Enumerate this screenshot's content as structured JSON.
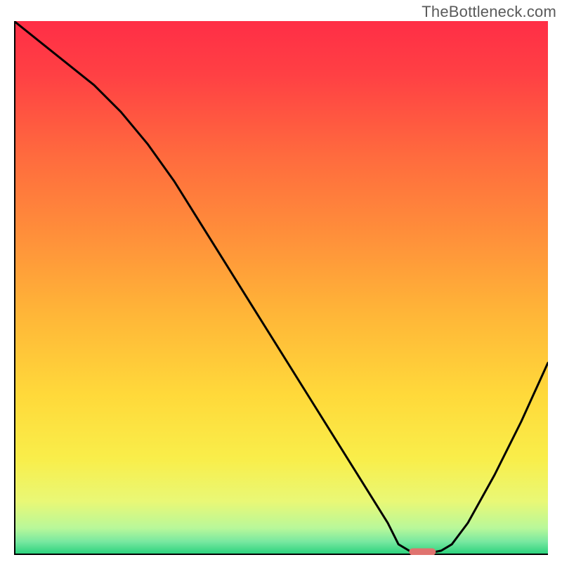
{
  "watermark": "TheBottleneck.com",
  "chart_data": {
    "type": "line",
    "title": "",
    "xlabel": "",
    "ylabel": "",
    "xlim": [
      0,
      100
    ],
    "ylim": [
      0,
      100
    ],
    "x": [
      0,
      5,
      10,
      15,
      20,
      25,
      30,
      35,
      40,
      45,
      50,
      55,
      60,
      65,
      70,
      72,
      74,
      76,
      78,
      80,
      82,
      85,
      90,
      95,
      100
    ],
    "values": [
      100,
      96,
      92,
      88,
      83,
      77,
      70,
      62,
      54,
      46,
      38,
      30,
      22,
      14,
      6,
      2,
      0.8,
      0.4,
      0.4,
      0.8,
      2,
      6,
      15,
      25,
      36
    ],
    "marker": {
      "x_range": [
        74,
        79
      ],
      "y": 0.6
    },
    "gradient_stops": [
      {
        "offset": 0.0,
        "color": "#ff2e46"
      },
      {
        "offset": 0.1,
        "color": "#ff4044"
      },
      {
        "offset": 0.25,
        "color": "#ff6a3e"
      },
      {
        "offset": 0.4,
        "color": "#ff8f3a"
      },
      {
        "offset": 0.55,
        "color": "#ffb638"
      },
      {
        "offset": 0.7,
        "color": "#ffd93a"
      },
      {
        "offset": 0.82,
        "color": "#f9ee4a"
      },
      {
        "offset": 0.9,
        "color": "#e9f876"
      },
      {
        "offset": 0.95,
        "color": "#b8f89a"
      },
      {
        "offset": 0.975,
        "color": "#78e8a0"
      },
      {
        "offset": 1.0,
        "color": "#25d07a"
      }
    ],
    "line_color": "#000000",
    "marker_color": "#e0736f",
    "axis_color": "#000000"
  }
}
